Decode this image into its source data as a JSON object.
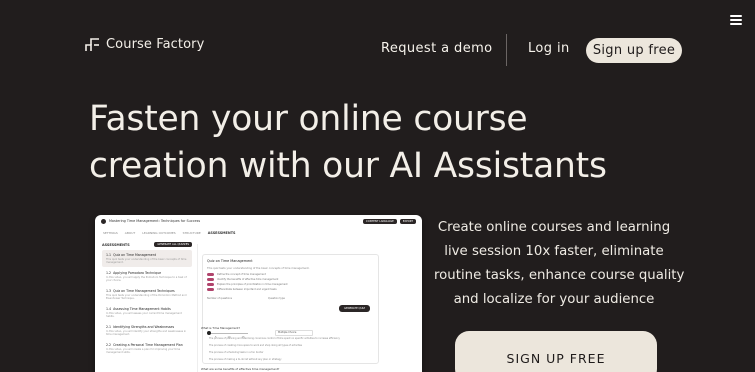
{
  "header": {
    "logo_text": "Course Factory",
    "request_demo": "Request a demo",
    "login": "Log in",
    "signup": "Sign up free"
  },
  "hero": {
    "title_line1": "Fasten your online course",
    "title_line2": "creation with our AI Assistants",
    "desc_lines": [
      "Create online courses and learning",
      "live session 10x faster, eliminate",
      "routine tasks, enhance course quality",
      "and localize for your audience"
    ],
    "cta": "SIGN UP FREE"
  },
  "card": {
    "course_title": "Mastering Time Management: Techniques for Success",
    "top_buttons": [
      "CONTENT LANGUAGE",
      "EXPORT"
    ],
    "tabs": [
      "SETTINGS",
      "ABOUT",
      "LEARNING OUTCOMES",
      "STRUCTURE",
      "ASSESSMENTS"
    ],
    "left_header": "ASSESSMENTS",
    "left_button": "GENERATE ALL QUIZZES",
    "lessons": [
      {
        "num": "1.1",
        "title": "Quiz on Time Management",
        "sub": "This quiz tests your understanding of the basic concepts of time management."
      },
      {
        "num": "1.2",
        "title": "Applying Pomodoro Technique",
        "sub": "In this video, you will apply the Pomodoro Technique to a task of your choice."
      },
      {
        "num": "1.3",
        "title": "Quiz on Time Management Techniques",
        "sub": "This quiz tests your understanding of the Pomodoro Method and Eisenhower Technique."
      },
      {
        "num": "1.4",
        "title": "Assessing Time Management Habits",
        "sub": "In this video, you will assess your current time management habits."
      },
      {
        "num": "2.1",
        "title": "Identifying Strengths and Weaknesses",
        "sub": "In this video, you will identify your strengths and weaknesses in time management."
      },
      {
        "num": "2.2",
        "title": "Creating a Personal Time Management Plan",
        "sub": "In this video, you will create a plan for improving your time management skills."
      }
    ],
    "quiz": {
      "title": "Quiz on Time Management",
      "desc": "This quiz tests your understanding of the basic concepts of time management.",
      "rows": [
        "Define the concept of time management",
        "Identify the benefits of effective time management",
        "Explain the principles of prioritization in time management",
        "Differentiate between important and urgent tasks"
      ],
      "num_questions_label": "Number of questions",
      "question_type_label": "Question type",
      "question_type_value": "Multiple Choice",
      "scale": [
        "5",
        "10",
        "15"
      ],
      "generate_button": "GENERATE QUIZ"
    },
    "questions": [
      {
        "q": "What is Time Management?",
        "answers": [
          "The process of planning and exercising conscious control of time spent on specific activities to increase efficiency",
          "The process of creating more spare to work and shop doing all types of activities",
          "The process of scheduling tasks in a fun border",
          "The process of making a to-do list without any plan or strategy"
        ]
      },
      {
        "q": "What are some benefits of effective time management?",
        "answers": []
      }
    ]
  }
}
